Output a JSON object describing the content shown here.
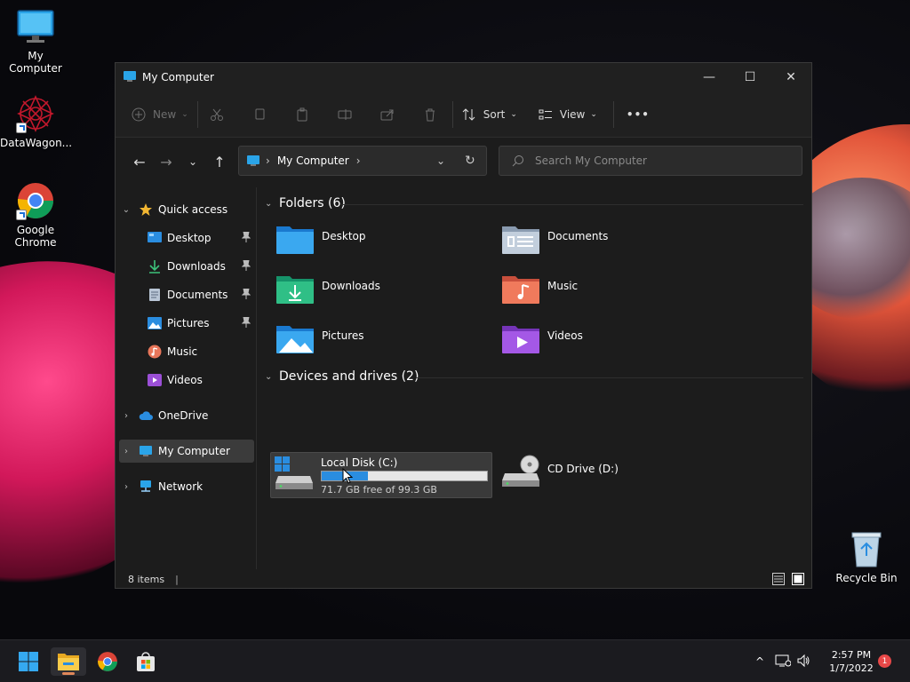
{
  "desktop": {
    "icons": [
      {
        "label": "My Computer"
      },
      {
        "label": "DataWagon..."
      },
      {
        "label": "Google Chrome"
      },
      {
        "label": "Recycle Bin"
      }
    ]
  },
  "window": {
    "title": "My Computer",
    "controls": {
      "minimize": "—",
      "maximize": "☐",
      "close": "✕"
    },
    "toolbar": {
      "new_label": "New",
      "sort_label": "Sort",
      "view_label": "View",
      "more_label": "•••"
    },
    "address": {
      "path": "My Computer"
    },
    "search": {
      "placeholder": "Search My Computer"
    },
    "sidebar": {
      "quick_access": "Quick access",
      "items": [
        {
          "label": "Desktop"
        },
        {
          "label": "Downloads"
        },
        {
          "label": "Documents"
        },
        {
          "label": "Pictures"
        },
        {
          "label": "Music"
        },
        {
          "label": "Videos"
        }
      ],
      "onedrive": "OneDrive",
      "my_computer": "My Computer",
      "network": "Network"
    },
    "folders": {
      "heading": "Folders (6)",
      "items": [
        {
          "label": "Desktop"
        },
        {
          "label": "Documents"
        },
        {
          "label": "Downloads"
        },
        {
          "label": "Music"
        },
        {
          "label": "Pictures"
        },
        {
          "label": "Videos"
        }
      ]
    },
    "devices": {
      "heading": "Devices and drives (2)",
      "local_disk": {
        "name": "Local Disk (C:)",
        "free_text": "71.7 GB free of 99.3 GB",
        "used_fraction": 0.278
      },
      "cd_drive": {
        "name": "CD Drive (D:)"
      }
    },
    "status": {
      "items": "8 items"
    }
  },
  "taskbar": {
    "time": "2:57 PM",
    "date": "1/7/2022",
    "notification_count": "1"
  },
  "colors": {
    "accent": "#2a8de0",
    "window_bg": "#1c1c1c",
    "selection": "#3b3b3b"
  }
}
